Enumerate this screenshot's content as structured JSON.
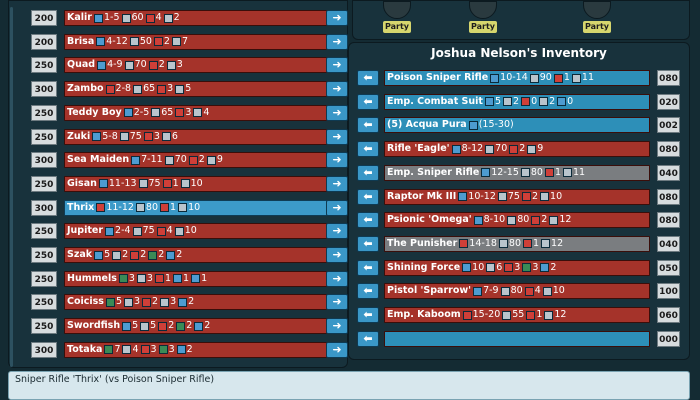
{
  "shop": {
    "items": [
      {
        "price": "200",
        "name": "Kalir",
        "stats": [
          [
            "b",
            "1-5"
          ],
          [
            "s",
            "60"
          ],
          [
            "r",
            "4"
          ],
          [
            "s",
            "2"
          ]
        ],
        "style": "red"
      },
      {
        "price": "200",
        "name": "Brisa",
        "stats": [
          [
            "b",
            "4-12"
          ],
          [
            "s",
            "50"
          ],
          [
            "r",
            "2"
          ],
          [
            "s",
            "7"
          ]
        ],
        "style": "red"
      },
      {
        "price": "250",
        "name": "Quad",
        "stats": [
          [
            "b",
            "4-9"
          ],
          [
            "s",
            "70"
          ],
          [
            "r",
            "2"
          ],
          [
            "s",
            "3"
          ]
        ],
        "style": "red"
      },
      {
        "price": "300",
        "name": "Zambo",
        "stats": [
          [
            "r",
            "2-8"
          ],
          [
            "s",
            "65"
          ],
          [
            "r",
            "3"
          ],
          [
            "s",
            "5"
          ]
        ],
        "style": "red"
      },
      {
        "price": "250",
        "name": "Teddy Boy",
        "stats": [
          [
            "b",
            "2-5"
          ],
          [
            "s",
            "65"
          ],
          [
            "r",
            "3"
          ],
          [
            "s",
            "4"
          ]
        ],
        "style": "red"
      },
      {
        "price": "250",
        "name": "Zuki",
        "stats": [
          [
            "b",
            "5-8"
          ],
          [
            "s",
            "75"
          ],
          [
            "r",
            "3"
          ],
          [
            "s",
            "6"
          ]
        ],
        "style": "red"
      },
      {
        "price": "300",
        "name": "Sea Maiden",
        "stats": [
          [
            "b",
            "7-11"
          ],
          [
            "s",
            "70"
          ],
          [
            "r",
            "2"
          ],
          [
            "s",
            "9"
          ]
        ],
        "style": "red"
      },
      {
        "price": "250",
        "name": "Gisan",
        "stats": [
          [
            "b",
            "11-13"
          ],
          [
            "s",
            "75"
          ],
          [
            "r",
            "1"
          ],
          [
            "s",
            "10"
          ]
        ],
        "style": "red"
      },
      {
        "price": "300",
        "name": "Thrix",
        "stats": [
          [
            "r",
            "11-12"
          ],
          [
            "s",
            "80"
          ],
          [
            "r",
            "1"
          ],
          [
            "s",
            "10"
          ]
        ],
        "style": "sel"
      },
      {
        "price": "250",
        "name": "Jupiter",
        "stats": [
          [
            "b",
            "2-4"
          ],
          [
            "s",
            "75"
          ],
          [
            "r",
            "4"
          ],
          [
            "s",
            "10"
          ]
        ],
        "style": "red"
      },
      {
        "price": "250",
        "name": "Szak",
        "stats": [
          [
            "b",
            "5"
          ],
          [
            "s",
            "2"
          ],
          [
            "r",
            "2"
          ],
          [
            "g",
            "2"
          ],
          [
            "b",
            "2"
          ]
        ],
        "style": "red"
      },
      {
        "price": "250",
        "name": "Hummels",
        "stats": [
          [
            "g",
            "3"
          ],
          [
            "s",
            "3"
          ],
          [
            "r",
            "1"
          ],
          [
            "b",
            "1"
          ],
          [
            "b",
            "1"
          ]
        ],
        "style": "red"
      },
      {
        "price": "250",
        "name": "Coiciss",
        "stats": [
          [
            "g",
            "5"
          ],
          [
            "s",
            "3"
          ],
          [
            "r",
            "2"
          ],
          [
            "s",
            "3"
          ],
          [
            "b",
            "2"
          ]
        ],
        "style": "red"
      },
      {
        "price": "250",
        "name": "Swordfish",
        "stats": [
          [
            "b",
            "5"
          ],
          [
            "s",
            "5"
          ],
          [
            "r",
            "2"
          ],
          [
            "g",
            "2"
          ],
          [
            "b",
            "2"
          ]
        ],
        "style": "red"
      },
      {
        "price": "300",
        "name": "Totaka",
        "stats": [
          [
            "g",
            "7"
          ],
          [
            "s",
            "4"
          ],
          [
            "r",
            "3"
          ],
          [
            "g",
            "3"
          ],
          [
            "b",
            "2"
          ]
        ],
        "style": "red"
      }
    ]
  },
  "party": {
    "labels": [
      "Party",
      "Party",
      "Party"
    ]
  },
  "inventory": {
    "title": "Joshua Nelson's Inventory",
    "items": [
      {
        "slot": "080",
        "name": "Poison Sniper Rifle",
        "stats": [
          [
            "b",
            "10-14"
          ],
          [
            "s",
            "90"
          ],
          [
            "r",
            "1"
          ],
          [
            "s",
            "11"
          ]
        ],
        "style": "teal"
      },
      {
        "slot": "020",
        "name": "Emp. Combat Suit",
        "stats": [
          [
            "b",
            "5"
          ],
          [
            "s",
            "2"
          ],
          [
            "r",
            "0"
          ],
          [
            "s",
            "2"
          ],
          [
            "b",
            "0"
          ]
        ],
        "style": "teal"
      },
      {
        "slot": "002",
        "name": "(5) Acqua Pura",
        "stats": [
          [
            "b",
            "(15-30)"
          ]
        ],
        "style": "teal"
      },
      {
        "slot": "080",
        "name": "Rifle 'Eagle'",
        "stats": [
          [
            "b",
            "8-12"
          ],
          [
            "s",
            "70"
          ],
          [
            "r",
            "2"
          ],
          [
            "s",
            "9"
          ]
        ],
        "style": "red"
      },
      {
        "slot": "040",
        "name": "Emp. Sniper Rifle",
        "stats": [
          [
            "b",
            "12-15"
          ],
          [
            "s",
            "80"
          ],
          [
            "r",
            "1"
          ],
          [
            "s",
            "11"
          ]
        ],
        "style": "gray"
      },
      {
        "slot": "080",
        "name": "Raptor Mk III",
        "stats": [
          [
            "b",
            "10-12"
          ],
          [
            "s",
            "75"
          ],
          [
            "r",
            "2"
          ],
          [
            "s",
            "10"
          ]
        ],
        "style": "red"
      },
      {
        "slot": "080",
        "name": "Psionic 'Omega'",
        "stats": [
          [
            "b",
            "8-10"
          ],
          [
            "s",
            "80"
          ],
          [
            "r",
            "2"
          ],
          [
            "s",
            "12"
          ]
        ],
        "style": "red"
      },
      {
        "slot": "040",
        "name": "The Punisher",
        "stats": [
          [
            "r",
            "14-18"
          ],
          [
            "s",
            "80"
          ],
          [
            "r",
            "1"
          ],
          [
            "s",
            "12"
          ]
        ],
        "style": "gray"
      },
      {
        "slot": "050",
        "name": "Shining Force",
        "stats": [
          [
            "b",
            "10"
          ],
          [
            "s",
            "6"
          ],
          [
            "r",
            "3"
          ],
          [
            "g",
            "3"
          ],
          [
            "b",
            "2"
          ]
        ],
        "style": "red"
      },
      {
        "slot": "100",
        "name": "Pistol 'Sparrow'",
        "stats": [
          [
            "b",
            "7-9"
          ],
          [
            "s",
            "80"
          ],
          [
            "r",
            "4"
          ],
          [
            "s",
            "10"
          ]
        ],
        "style": "red"
      },
      {
        "slot": "060",
        "name": "Emp. Kaboom",
        "stats": [
          [
            "r",
            "15-20"
          ],
          [
            "s",
            "55"
          ],
          [
            "r",
            "1"
          ],
          [
            "s",
            "12"
          ]
        ],
        "style": "red"
      },
      {
        "slot": "000",
        "name": "",
        "stats": [],
        "style": "teal"
      }
    ]
  },
  "compare": {
    "text": "Sniper Rifle 'Thrix' (vs Poison Sniper Rifle)"
  },
  "buttons": {
    "right_arrow": "➜",
    "left_arrow": "⬅"
  }
}
